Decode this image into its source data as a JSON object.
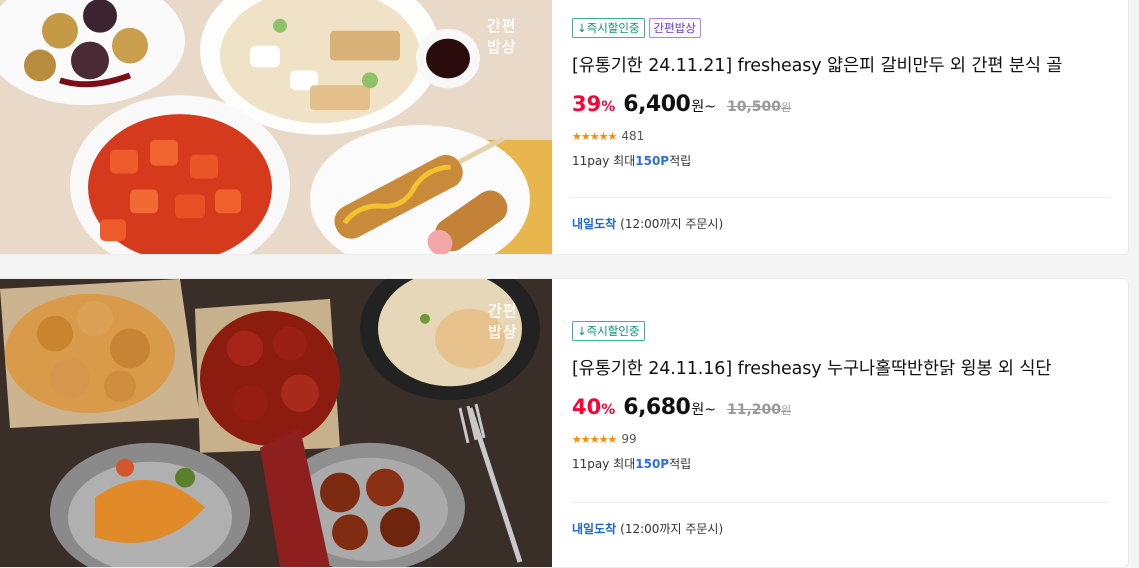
{
  "products": [
    {
      "badges": [
        {
          "label": "↓즉시할인중",
          "style": "green"
        },
        {
          "label": "간편밥상",
          "style": "purple"
        }
      ],
      "watermark": [
        "간편",
        "밥상"
      ],
      "title": "[유통기한 24.11.21] fresheasy 얇은피 갈비만두 외 간편 분식 골",
      "discount": "39",
      "discount_unit": "%",
      "price": "6,400",
      "price_unit": "원~",
      "original_price": "10,500",
      "original_unit": "원",
      "stars": "★★★★★",
      "rating": 4.5,
      "review_count": "481",
      "points_prefix": "11pay 최대",
      "points_value": "150P",
      "points_suffix": "적립",
      "delivery_label": "내일도착",
      "delivery_note": "(12:00까지 주문시)"
    },
    {
      "badges": [
        {
          "label": "↓즉시할인중",
          "style": "green"
        }
      ],
      "watermark": [
        "간편",
        "밥상"
      ],
      "title": "[유통기한 24.11.16] fresheasy 누구나홀딱반한닭 윙봉 외 식단",
      "discount": "40",
      "discount_unit": "%",
      "price": "6,680",
      "price_unit": "원~",
      "original_price": "11,200",
      "original_unit": "원",
      "stars": "★★★★★",
      "rating": 4.5,
      "review_count": "99",
      "points_prefix": "11pay 최대",
      "points_value": "150P",
      "points_suffix": "적립",
      "delivery_label": "내일도착",
      "delivery_note": "(12:00까지 주문시)"
    }
  ],
  "colors": {
    "discount": "#ff0038",
    "points": "#2d6fdc",
    "delivery": "#1f66d1",
    "stars": "#ff8a00",
    "badge_green": "#0f8f72",
    "badge_purple": "#6c3cc9"
  }
}
